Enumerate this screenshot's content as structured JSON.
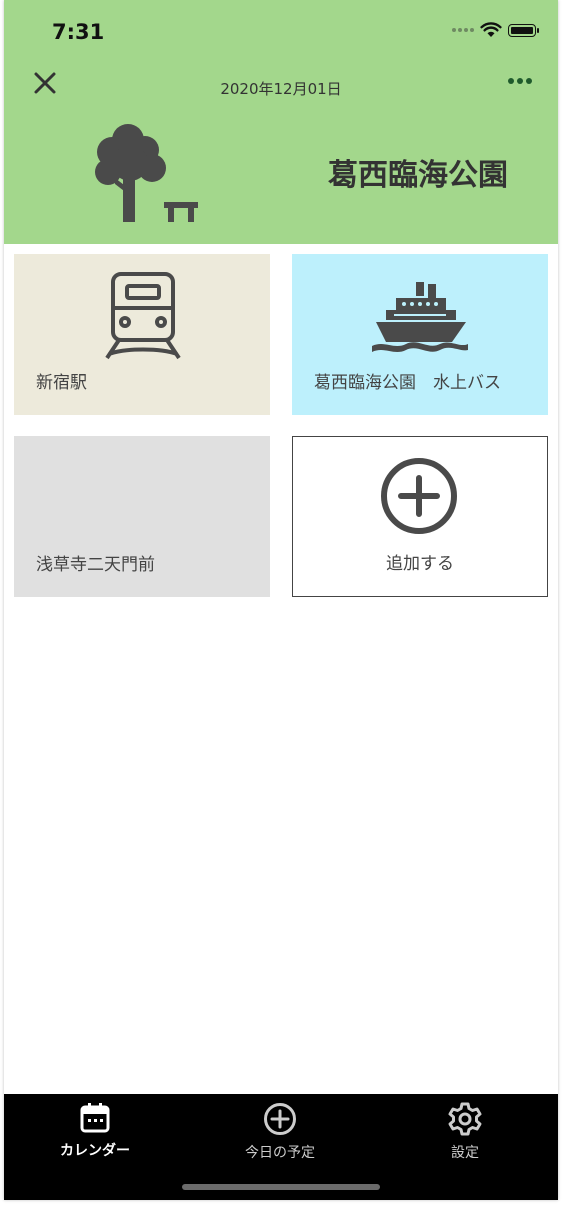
{
  "status_bar": {
    "time": "7:31"
  },
  "header": {
    "date": "2020年12月01日",
    "place": "葛西臨海公園",
    "close_icon": "close-icon",
    "more_icon": "more-icon",
    "illustration": "tree-bench-icon",
    "background_color": "#a3d78c"
  },
  "tiles": [
    {
      "label": "新宿駅",
      "icon": "train-icon",
      "color": "#edeadb"
    },
    {
      "label": "葛西臨海公園　水上バス",
      "icon": "ship-icon",
      "color": "#bdf0fc"
    },
    {
      "label": "浅草寺二天門前",
      "icon": "",
      "color": "#e0e0e0"
    },
    {
      "label": "追加する",
      "icon": "add-circle-icon",
      "color": "#ffffff"
    }
  ],
  "tab_bar": {
    "tabs": [
      {
        "label": "カレンダー",
        "icon": "calendar-icon",
        "active": true
      },
      {
        "label": "今日の予定",
        "icon": "add-circle-icon",
        "active": false
      },
      {
        "label": "設定",
        "icon": "gear-icon",
        "active": false
      }
    ]
  }
}
